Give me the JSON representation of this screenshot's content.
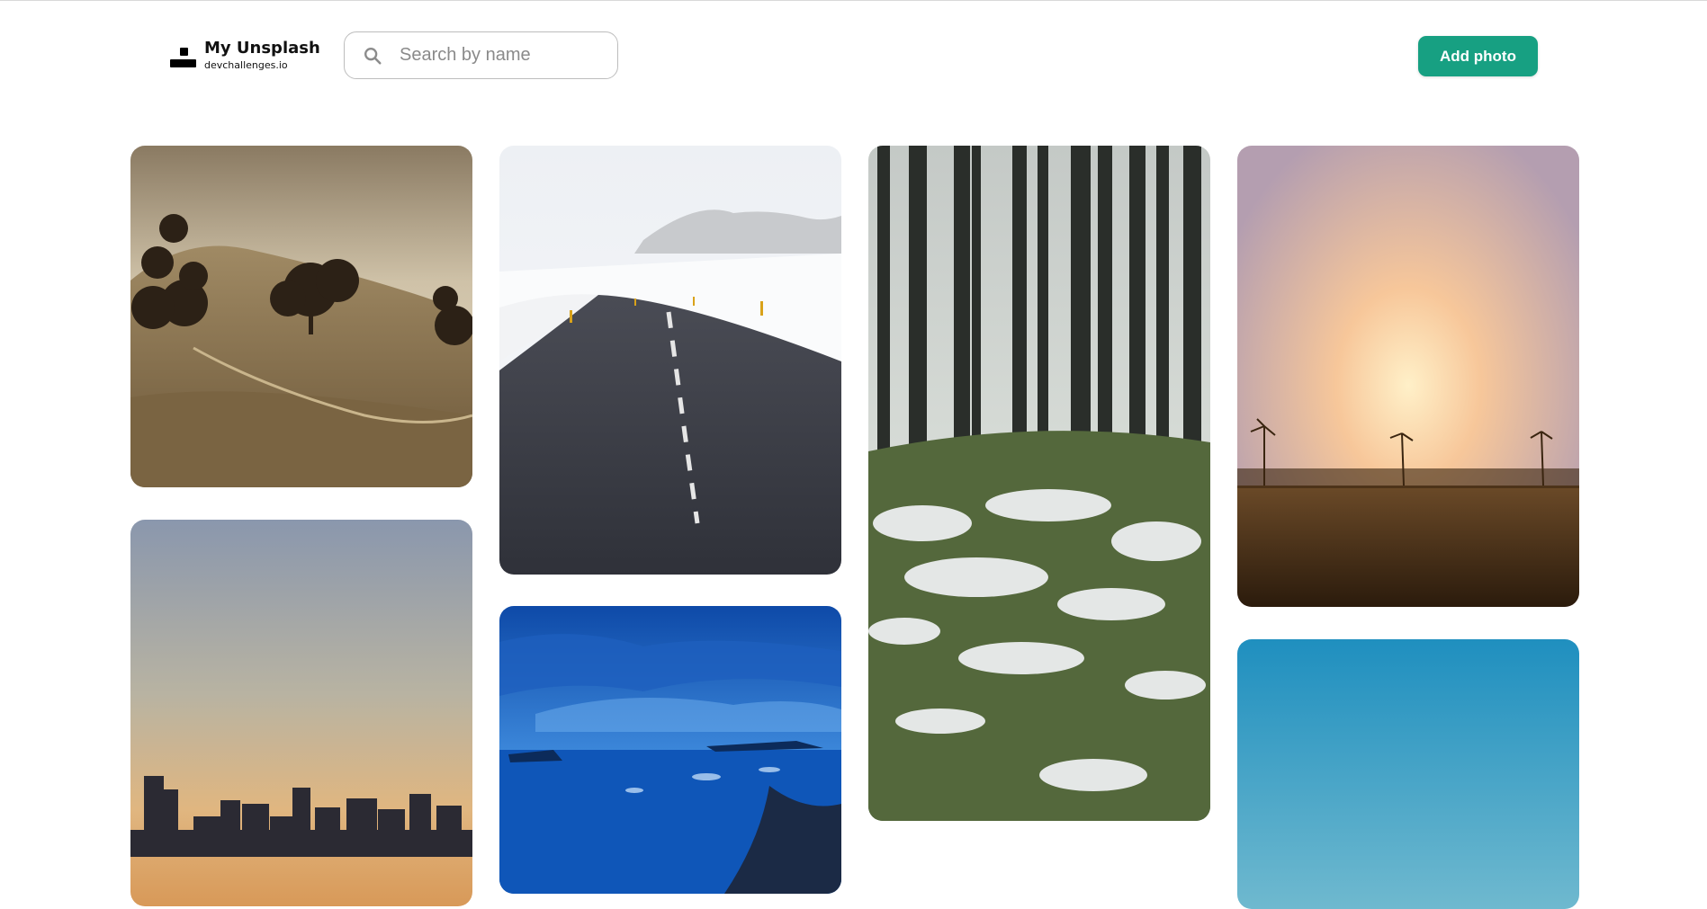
{
  "brand": {
    "name": "My Unsplash",
    "subtitle": "devchallenges.io"
  },
  "search": {
    "placeholder": "Search by name",
    "value": ""
  },
  "actions": {
    "add_photo_label": "Add photo"
  },
  "icons": {
    "logo": "unsplash-logo-icon",
    "search": "search-icon"
  },
  "colors": {
    "accent": "#17a082"
  },
  "photos": [
    {
      "subject": "sepia hills with oak trees"
    },
    {
      "subject": "snowy road curving into mountains"
    },
    {
      "subject": "misty forest with snow patches"
    },
    {
      "subject": "sunset over windblown palm trees"
    },
    {
      "subject": "city skyline at dusk"
    },
    {
      "subject": "blue ice lagoon at twilight"
    },
    {
      "subject": "clear blue sky"
    }
  ]
}
